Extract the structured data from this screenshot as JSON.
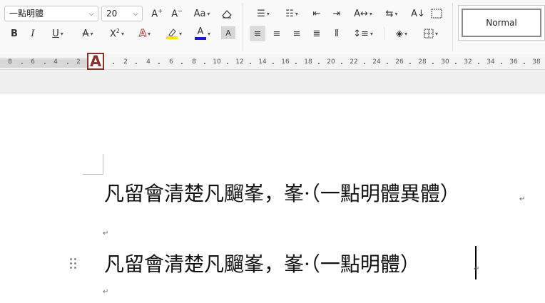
{
  "toolbar": {
    "font_name": "一點明體",
    "font_size": "20",
    "style_name": "Normal",
    "colors": {
      "highlight": "#f5e400",
      "font_color": "#1a1acb",
      "border_accent": "#8b2e2e"
    }
  },
  "ruler": {
    "left_labels": [
      "8",
      "6",
      "4",
      "2"
    ],
    "right_labels": [
      "2",
      "4",
      "6",
      "8",
      "10",
      "12",
      "14",
      "16",
      "18",
      "20",
      "22",
      "24",
      "26",
      "28",
      "30",
      "32",
      "34",
      "36",
      "38"
    ]
  },
  "document": {
    "line1": "凡留會清楚凡飀峯，峯·（一點明體異體）",
    "line2": "凡留會清楚凡飀峯，峯·（一點明體）",
    "pilcrow": "↵"
  }
}
